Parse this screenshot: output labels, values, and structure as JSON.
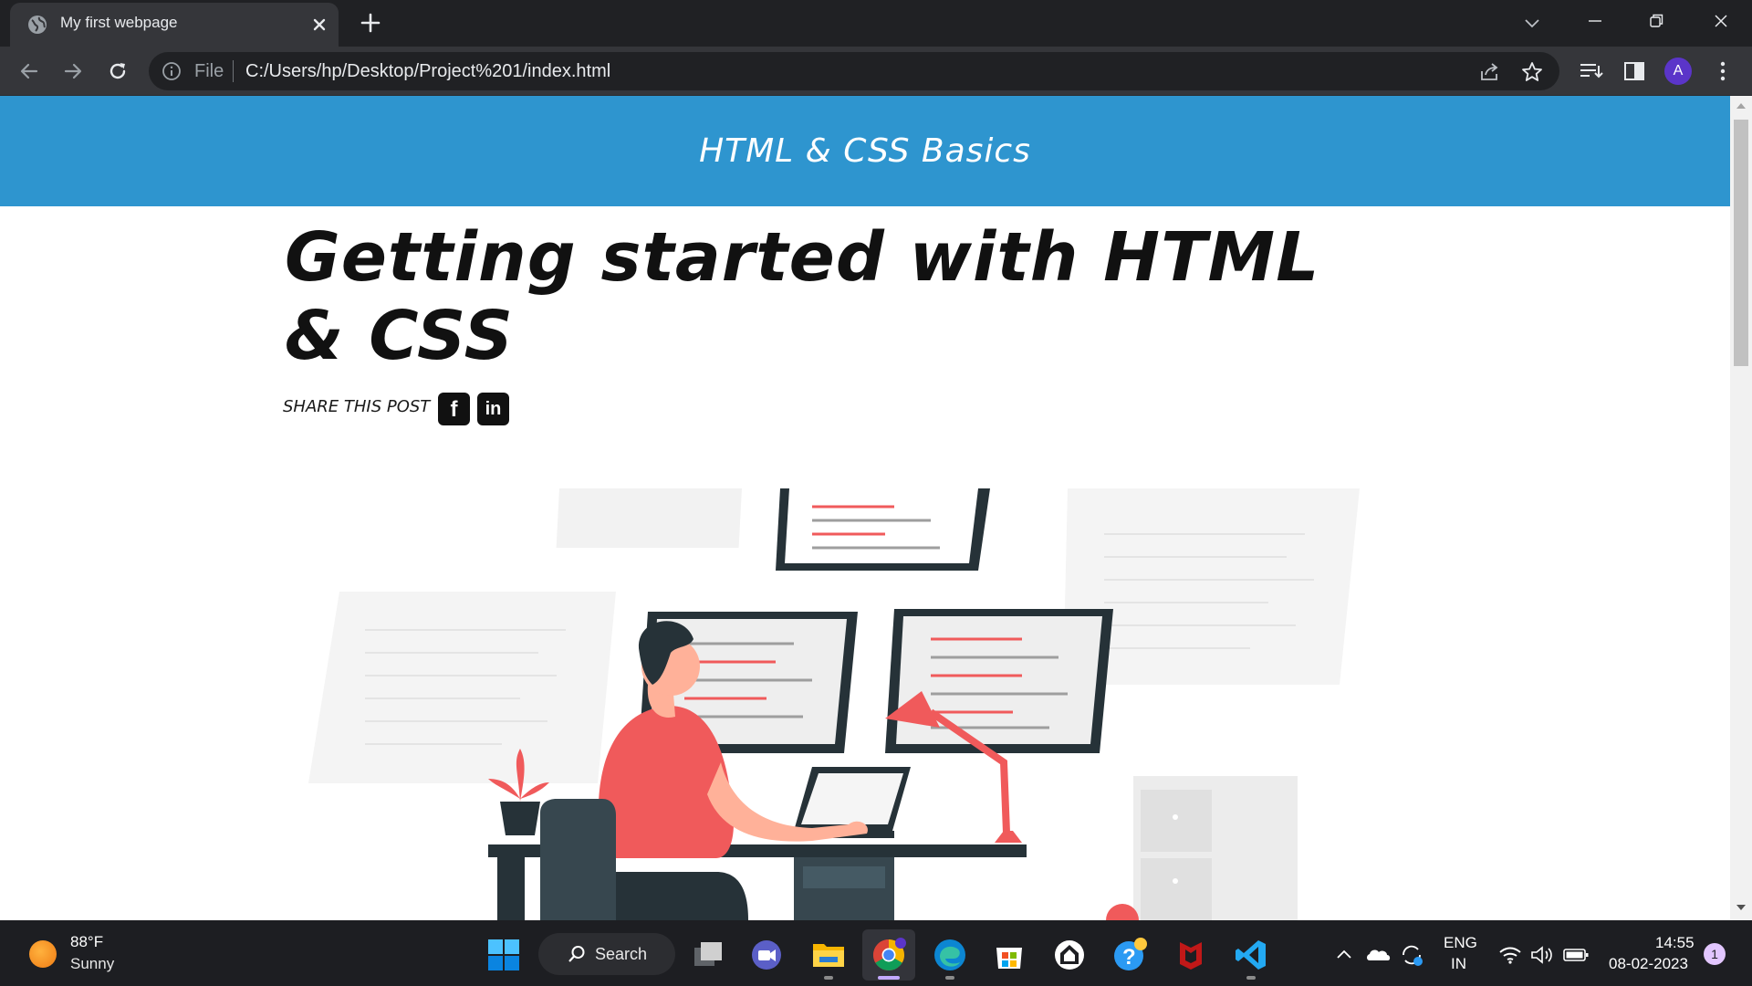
{
  "browser": {
    "tab_title": "My first webpage",
    "omnibox_scheme_label": "File",
    "omnibox_url": "C:/Users/hp/Desktop/Project%201/index.html",
    "profile_initial": "A"
  },
  "page": {
    "site_title": "HTML & CSS Basics",
    "post_title": "Getting started with HTML & CSS",
    "share_label": "SHARE THIS POST",
    "share_facebook_glyph": "f",
    "share_linkedin_glyph": "in",
    "colors": {
      "header_bg": "#2e95cf",
      "accent_red": "#f05a5b",
      "dark_teal": "#263238"
    }
  },
  "taskbar": {
    "weather_temp": "88°F",
    "weather_condition": "Sunny",
    "search_label": "Search",
    "language_line1": "ENG",
    "language_line2": "IN",
    "time": "14:55",
    "date": "08-02-2023",
    "notification_count": "1",
    "pinned_apps": [
      "windows-start",
      "search",
      "task-view",
      "teams-chat",
      "file-explorer",
      "chrome",
      "edge",
      "microsoft-store",
      "app-white",
      "get-help",
      "mcafee",
      "vscode"
    ]
  }
}
